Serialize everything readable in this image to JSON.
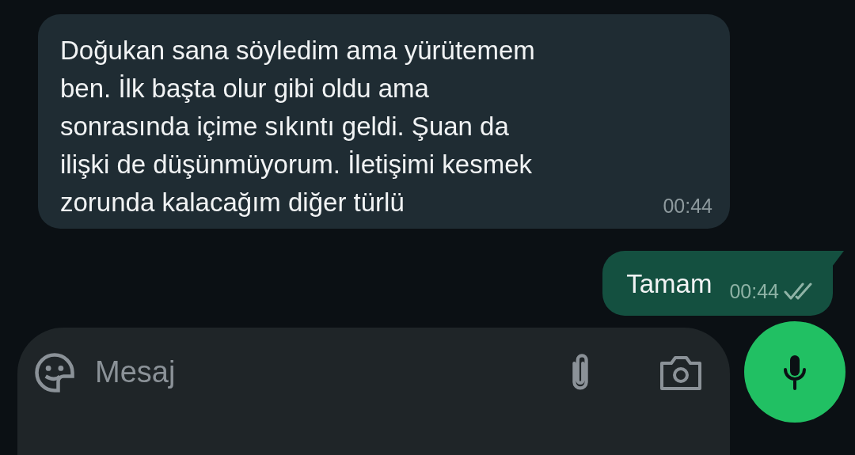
{
  "messages": [
    {
      "kind": "incoming",
      "text": "Doğukan sana söyledim ama yürütemem\nben. İlk başta olur gibi oldu ama\nsonrasında içime sıkıntı geldi. Şuan da\nilişki de düşünmüyorum. İletişimi kesmek\nzorunda kalacağım diğer türlü",
      "time": "00:44"
    },
    {
      "kind": "outgoing",
      "text": "Tamam",
      "time": "00:44",
      "read": false
    }
  ],
  "composer": {
    "placeholder": "Mesaj"
  }
}
